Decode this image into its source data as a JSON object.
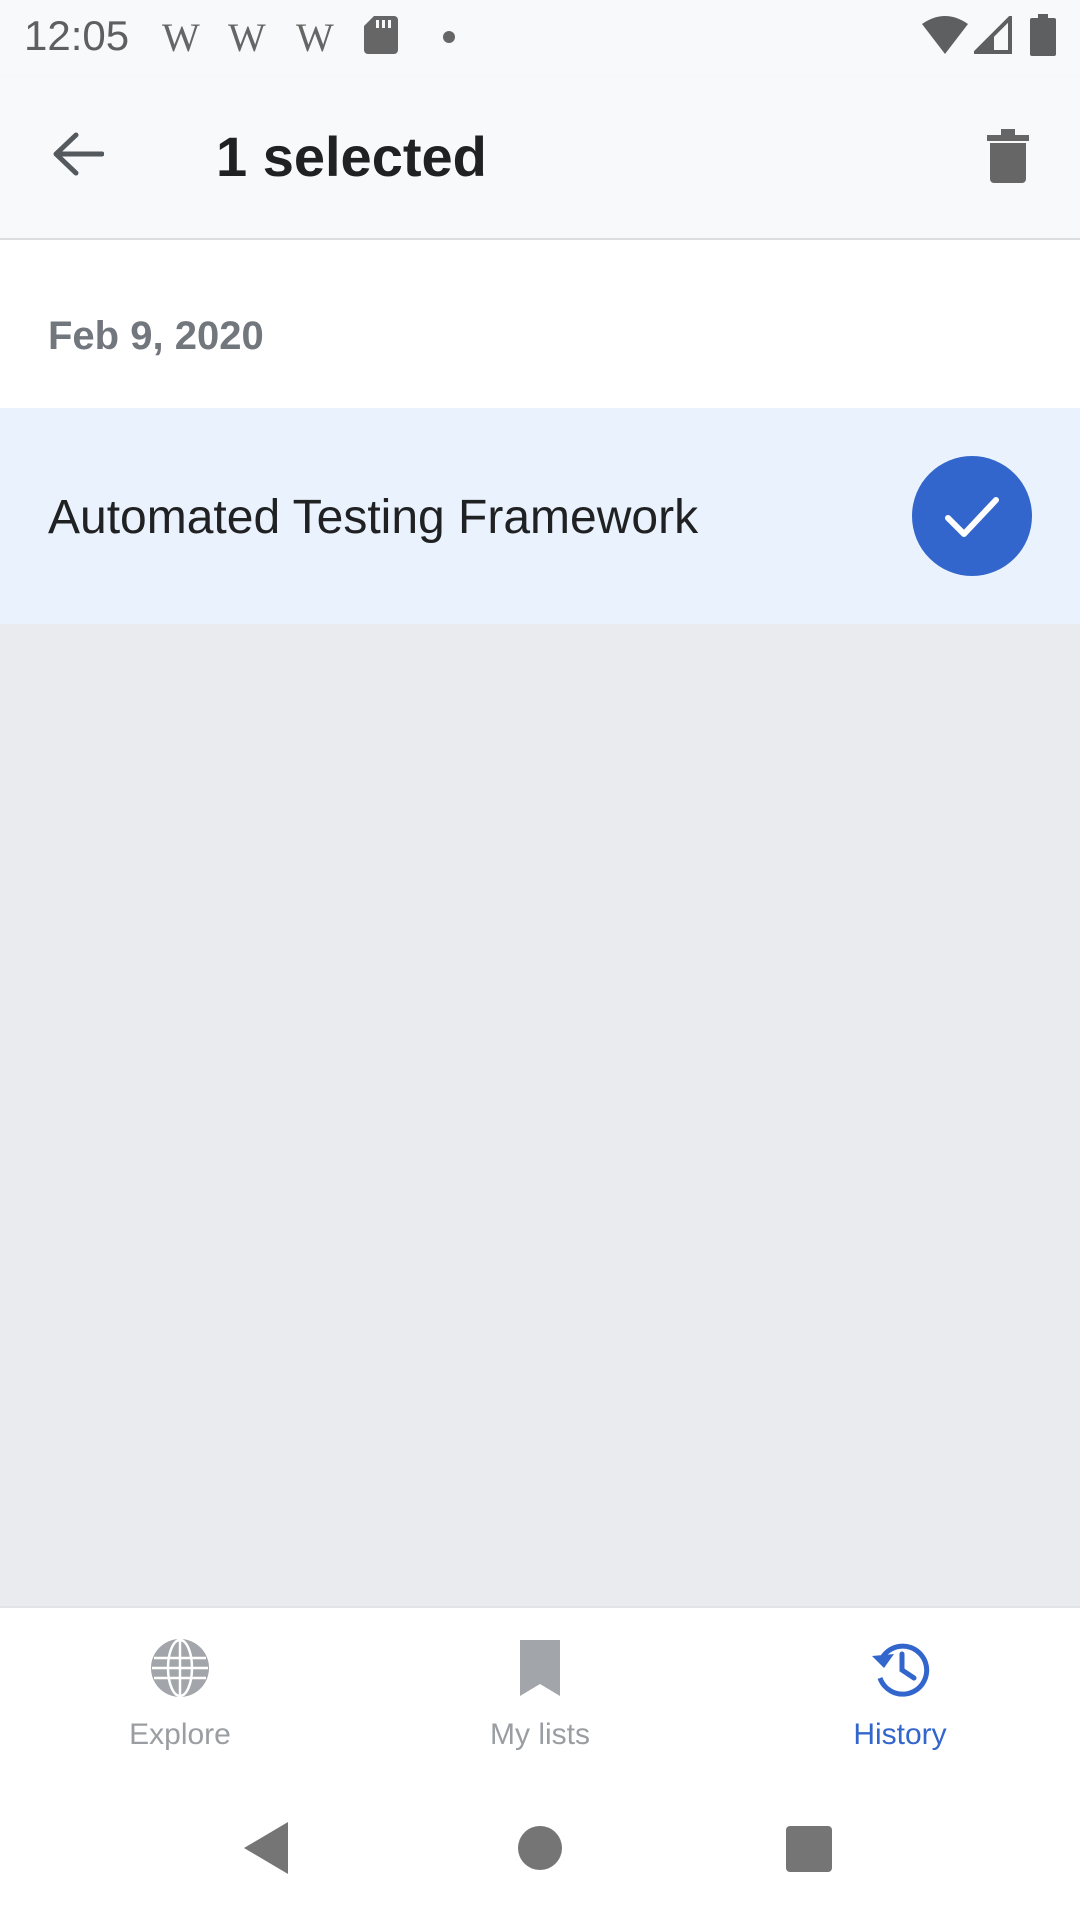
{
  "status_bar": {
    "time": "12:05",
    "notification_glyphs": [
      "W",
      "W",
      "W"
    ]
  },
  "app_bar": {
    "title": "1 selected",
    "back_icon": "arrow-back-icon",
    "delete_icon": "trash-icon"
  },
  "history": {
    "date": "Feb 9, 2020",
    "items": [
      {
        "title": "Automated Testing Framework",
        "selected": true
      }
    ]
  },
  "bottom_nav": {
    "tabs": [
      {
        "label": "Explore",
        "icon": "globe-icon",
        "active": false
      },
      {
        "label": "My lists",
        "icon": "bookmark-icon",
        "active": false
      },
      {
        "label": "History",
        "icon": "history-icon",
        "active": true
      }
    ]
  },
  "colors": {
    "accent": "#3366cc",
    "selected_row": "#eaf2fd",
    "background": "#eaebef",
    "inactive_nav": "#9a9da1"
  }
}
